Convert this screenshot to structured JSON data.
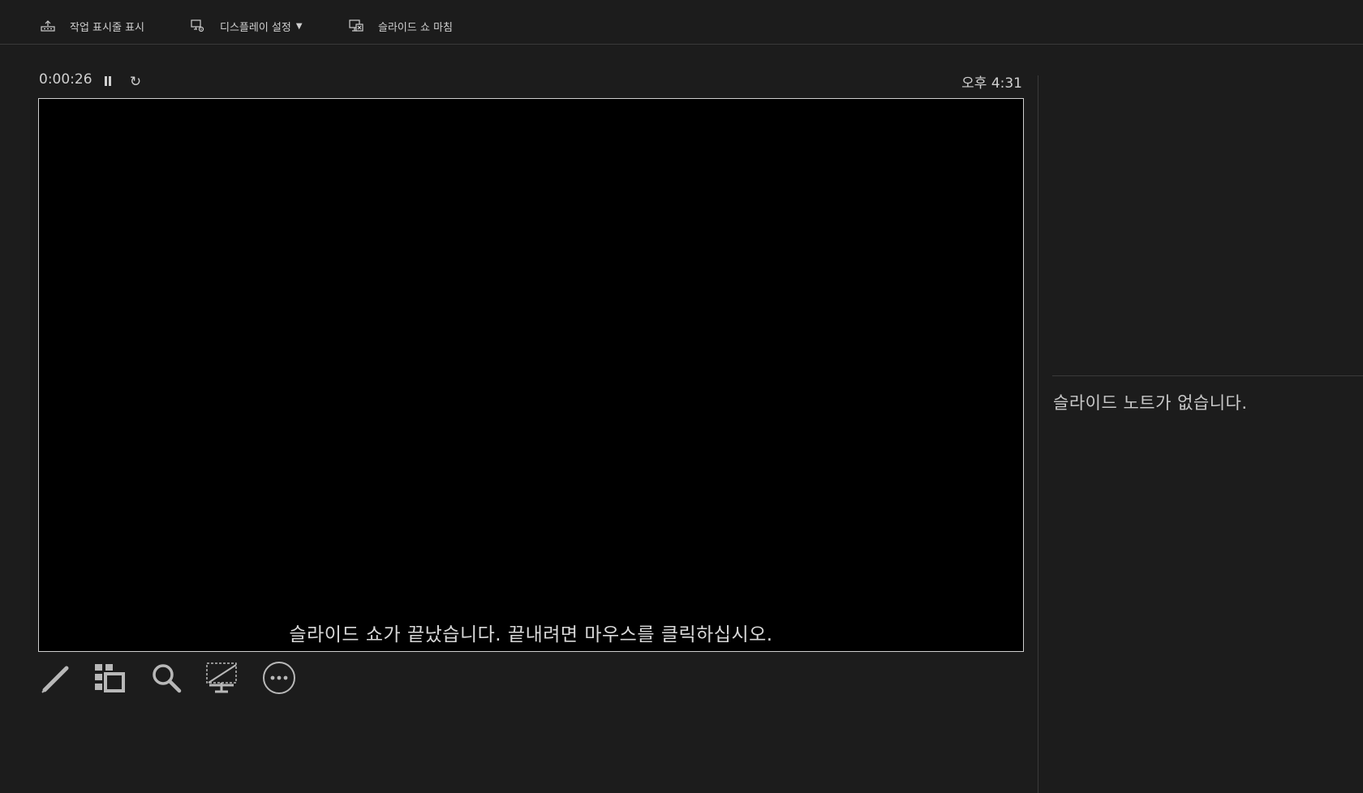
{
  "toolbar": {
    "show_taskbar_label": "작업 표시줄 표시",
    "display_settings_label": "디스플레이 설정",
    "end_slideshow_label": "슬라이드 쇼 마침"
  },
  "presenter": {
    "elapsed_time": "0:00:26",
    "pause_icon_glyph": "⏸",
    "restart_icon_glyph": "↻",
    "clock": "오후 4:31"
  },
  "slide": {
    "end_message": "슬라이드 쇼가 끝났습니다. 끝내려면 마우스를 클릭하십시오."
  },
  "tools": [
    {
      "name": "pen-icon"
    },
    {
      "name": "see-all-slides-icon"
    },
    {
      "name": "zoom-icon"
    },
    {
      "name": "black-screen-icon"
    },
    {
      "name": "more-options-icon"
    }
  ],
  "notes": {
    "empty_text": "슬라이드 노트가 없습니다."
  },
  "colors": {
    "background": "#1c1c1c",
    "slide": "#000000",
    "text": "#c8c8c8",
    "divider": "#3a3a3a"
  }
}
